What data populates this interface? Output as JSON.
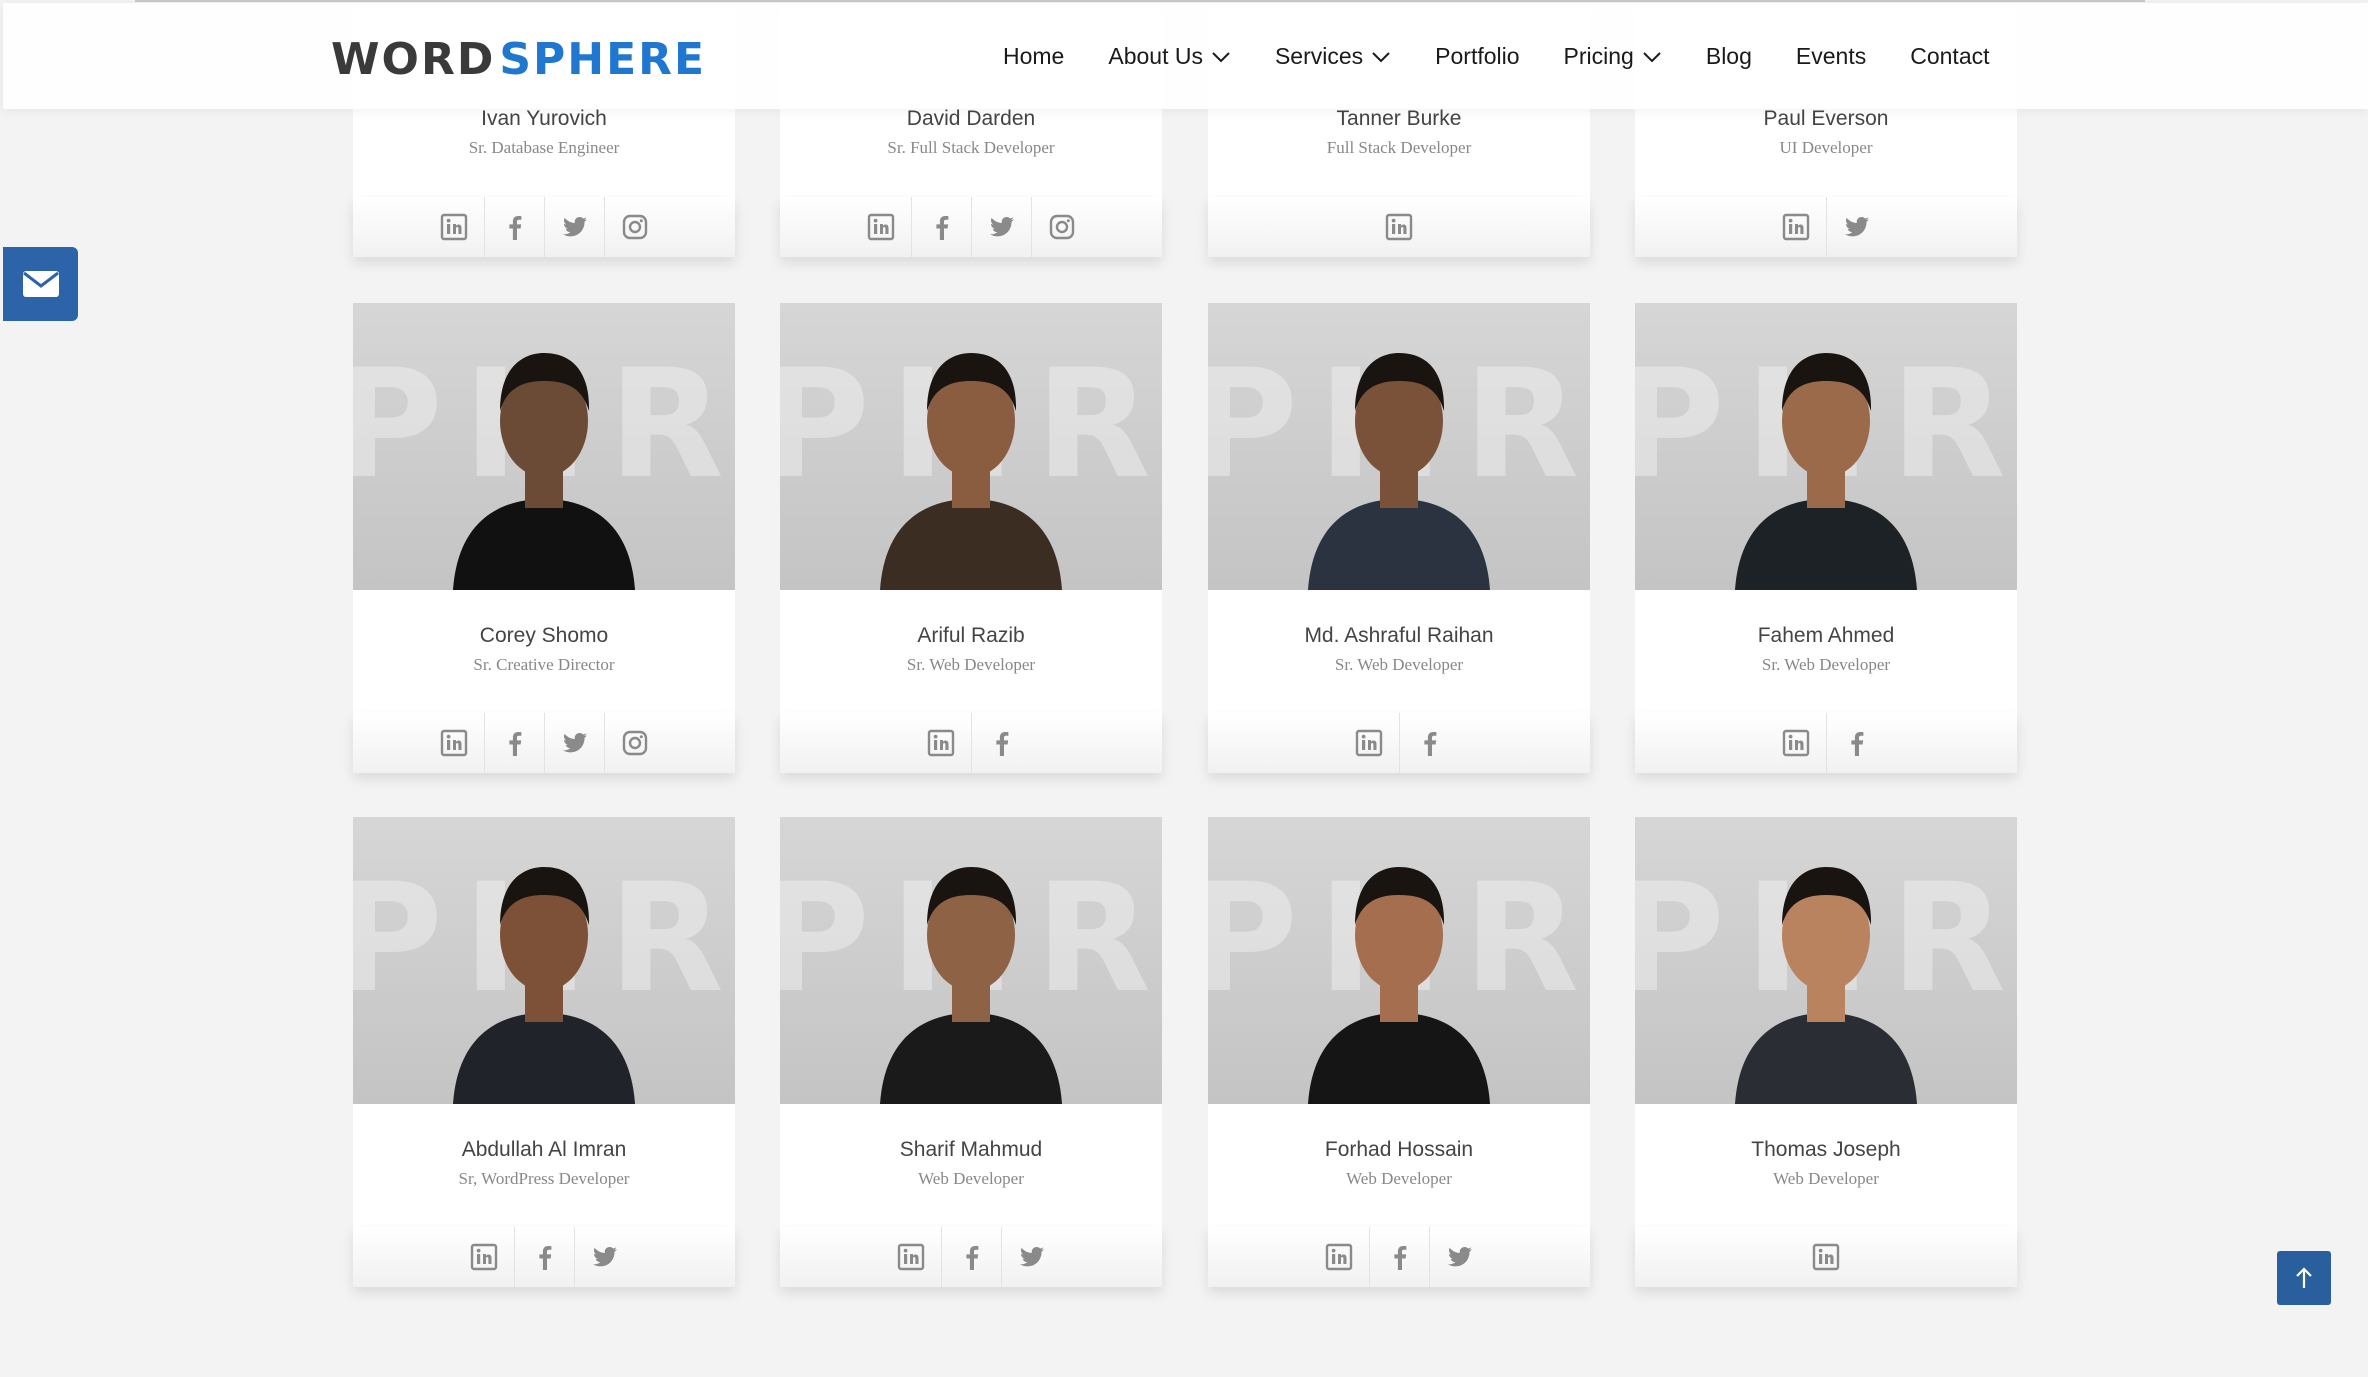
{
  "header": {
    "logo_word1": "WORD",
    "logo_word2": "SPHERE",
    "nav": [
      {
        "label": "Home",
        "dropdown": false
      },
      {
        "label": "About Us",
        "dropdown": true
      },
      {
        "label": "Services",
        "dropdown": true
      },
      {
        "label": "Portfolio",
        "dropdown": false
      },
      {
        "label": "Pricing",
        "dropdown": true
      },
      {
        "label": "Blog",
        "dropdown": false
      },
      {
        "label": "Events",
        "dropdown": false
      },
      {
        "label": "Contact",
        "dropdown": false
      }
    ]
  },
  "team_partial": [
    {
      "name": "Ivan Yurovich",
      "role": "Sr. Database Engineer",
      "socials": [
        "linkedin",
        "facebook",
        "twitter",
        "instagram"
      ]
    },
    {
      "name": "David Darden",
      "role": "Sr. Full Stack Developer",
      "socials": [
        "linkedin",
        "facebook",
        "twitter",
        "instagram"
      ]
    },
    {
      "name": "Tanner Burke",
      "role": "Full Stack Developer",
      "socials": [
        "linkedin"
      ]
    },
    {
      "name": "Paul Everson",
      "role": "UI Developer",
      "socials": [
        "linkedin",
        "twitter"
      ]
    }
  ],
  "team": [
    {
      "name": "Corey Shomo",
      "role": "Sr. Creative Director",
      "socials": [
        "linkedin",
        "facebook",
        "twitter",
        "instagram"
      ]
    },
    {
      "name": "Ariful Razib",
      "role": "Sr. Web Developer",
      "socials": [
        "linkedin",
        "facebook"
      ]
    },
    {
      "name": "Md. Ashraful Raihan",
      "role": "Sr. Web Developer",
      "socials": [
        "linkedin",
        "facebook"
      ]
    },
    {
      "name": "Fahem Ahmed",
      "role": "Sr. Web Developer",
      "socials": [
        "linkedin",
        "facebook"
      ]
    },
    {
      "name": "Abdullah Al Imran",
      "role": "Sr, WordPress Developer",
      "socials": [
        "linkedin",
        "facebook",
        "twitter"
      ]
    },
    {
      "name": "Sharif Mahmud",
      "role": "Web Developer",
      "socials": [
        "linkedin",
        "facebook",
        "twitter"
      ]
    },
    {
      "name": "Forhad Hossain",
      "role": "Web Developer",
      "socials": [
        "linkedin",
        "facebook",
        "twitter"
      ]
    },
    {
      "name": "Thomas Joseph",
      "role": "Web Developer",
      "socials": [
        "linkedin"
      ]
    }
  ],
  "photo_watermark": "PHR",
  "colors": {
    "brand_blue": "#1f77d0",
    "accent_button": "#2a5f9e",
    "icon_gray": "#8a8a8a"
  },
  "icons": {
    "mail_tab": "envelope-icon",
    "back_to_top": "arrow-up-icon"
  }
}
